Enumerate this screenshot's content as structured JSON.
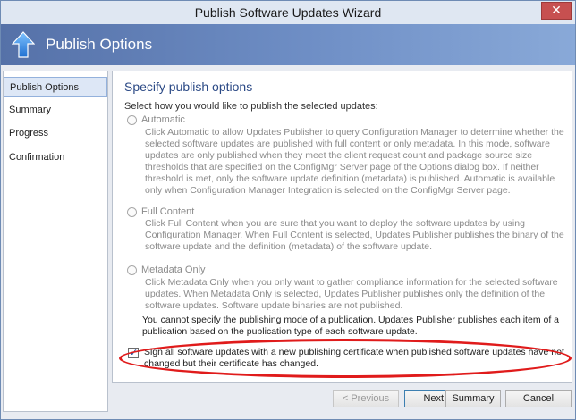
{
  "window": {
    "title": "Publish Software Updates Wizard",
    "close_glyph": "✕"
  },
  "header": {
    "title": "Publish Options",
    "icon": "up-arrow-icon"
  },
  "nav": {
    "items": [
      {
        "label": "Publish Options",
        "active": true
      },
      {
        "label": "Summary",
        "active": false
      },
      {
        "label": "Progress",
        "active": false
      },
      {
        "label": "Confirmation",
        "active": false
      }
    ]
  },
  "main": {
    "section_title": "Specify publish options",
    "intro": "Select how you would like to publish the selected updates:",
    "options": [
      {
        "label": "Automatic",
        "selected": false,
        "enabled": false,
        "description": "Click Automatic to allow Updates Publisher to query  Configuration Manager to determine whether the selected software updates are published with full content or only metadata. In this mode, software updates are only published when they meet the client request count and package source size thresholds that are specified on the ConfigMgr Server page of the Options dialog box. If neither threshold is met, only the software update definition (metadata) is published. Automatic is available only when Configuration Manager Integration is selected on the ConfigMgr Server page."
      },
      {
        "label": "Full Content",
        "selected": false,
        "enabled": false,
        "description": "Click Full Content when you are sure that you want to deploy the software updates by using Configuration Manager. When Full Content is selected, Updates Publisher publishes the binary of the software update and the definition (metadata) of the software update."
      },
      {
        "label": "Metadata Only",
        "selected": false,
        "enabled": false,
        "description": "Click Metadata Only when you only want to gather compliance information for the selected software updates. When Metadata Only is selected, Updates Publisher publishes only the definition of the software updates. Software update binaries are not published."
      }
    ],
    "note": "You cannot specify the publishing mode of a publication. Updates Publisher publishes each item of a publication based on the publication type of each software update.",
    "checkbox": {
      "checked": true,
      "tick_glyph": "✓",
      "label": "Sign all software updates with a new publishing certificate when published software updates have not changed but their certificate has changed."
    }
  },
  "buttons": {
    "previous": "< Previous",
    "next": "Next >",
    "summary": "Summary",
    "cancel": "Cancel"
  },
  "colors": {
    "highlight_ring": "#e01b1b",
    "header_gradient_start": "#5571a8",
    "section_title": "#2c4a86",
    "close_button": "#c75050"
  }
}
